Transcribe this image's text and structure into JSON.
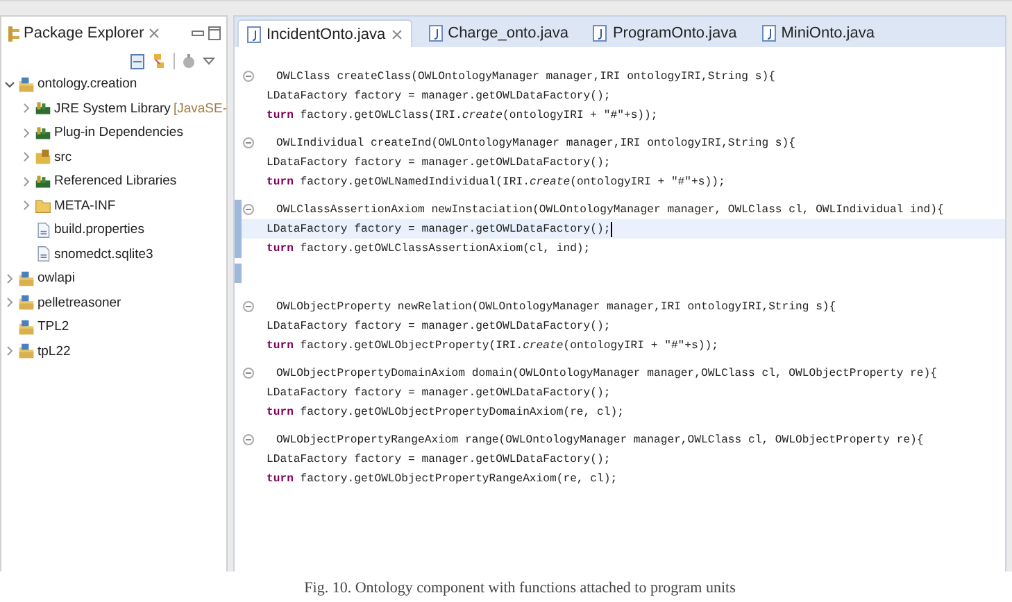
{
  "package_explorer": {
    "title": "Package Explorer",
    "tree": [
      {
        "label": "ontology.creation",
        "kind": "project",
        "expanded": true,
        "children": [
          {
            "label": "JRE System Library",
            "suffix": "[JavaSE-",
            "kind": "library",
            "expanded": false
          },
          {
            "label": "Plug-in Dependencies",
            "kind": "library",
            "expanded": false
          },
          {
            "label": "src",
            "kind": "source",
            "expanded": false
          },
          {
            "label": "Referenced Libraries",
            "kind": "library",
            "expanded": false
          },
          {
            "label": "META-INF",
            "kind": "folder",
            "expanded": false
          },
          {
            "label": "build.properties",
            "kind": "file"
          },
          {
            "label": "snomedct.sqlite3",
            "kind": "file"
          }
        ]
      },
      {
        "label": "owlapi",
        "kind": "project",
        "expanded": false
      },
      {
        "label": "pelletreasoner",
        "kind": "project",
        "expanded": false
      },
      {
        "label": "TPL2",
        "kind": "project"
      },
      {
        "label": "tpL22",
        "kind": "project",
        "expanded": false
      }
    ]
  },
  "editor": {
    "tabs": [
      {
        "label": "IncidentOnto.java",
        "selected": true
      },
      {
        "label": "Charge_onto.java",
        "selected": false
      },
      {
        "label": "ProgramOnto.java",
        "selected": false
      },
      {
        "label": "MiniOnto.java",
        "selected": false
      }
    ],
    "lines": [
      {
        "kind": "signature",
        "text": "OWLClass createClass(OWLOntologyManager manager,IRI ontologyIRI,String s){",
        "current": false,
        "marked": false
      },
      {
        "kind": "body",
        "text": "LDataFactory factory = manager.getOWLDataFactory();",
        "current": false,
        "marked": false
      },
      {
        "kind": "body",
        "text": "**turn** factory.getOWLClass(IRI.*create*(ontologyIRI + \"#\"+s));",
        "current": false,
        "marked": false
      },
      {
        "kind": "signature",
        "text": "OWLIndividual createInd(OWLOntologyManager manager,IRI ontologyIRI,String s){",
        "current": false,
        "marked": false
      },
      {
        "kind": "body",
        "text": "LDataFactory factory = manager.getOWLDataFactory();",
        "current": false,
        "marked": false
      },
      {
        "kind": "body",
        "text": "**turn**  factory.getOWLNamedIndividual(IRI.*create*(ontologyIRI + \"#\"+s));",
        "current": false,
        "marked": false
      },
      {
        "kind": "signature",
        "text": "OWLClassAssertionAxiom newInstaciation(OWLOntologyManager manager, OWLClass cl, OWLIndividual ind){",
        "current": false,
        "marked": true
      },
      {
        "kind": "body",
        "text": "LDataFactory factory = manager.getOWLDataFactory();",
        "current": true,
        "marked": true
      },
      {
        "kind": "body",
        "text": "**turn**  factory.getOWLClassAssertionAxiom(cl, ind);",
        "current": false,
        "marked": true
      },
      {
        "kind": "blank",
        "current": false,
        "marked": true
      },
      {
        "kind": "signature",
        "text": "OWLObjectProperty newRelation(OWLOntologyManager manager,IRI ontologyIRI,String s){",
        "current": false,
        "marked": false
      },
      {
        "kind": "body",
        "text": "LDataFactory factory = manager.getOWLDataFactory();",
        "current": false,
        "marked": false
      },
      {
        "kind": "body",
        "text": "**turn**  factory.getOWLObjectProperty(IRI.*create*(ontologyIRI + \"#\"+s));",
        "current": false,
        "marked": false
      },
      {
        "kind": "signature",
        "text": "OWLObjectPropertyDomainAxiom domain(OWLOntologyManager manager,OWLClass cl, OWLObjectProperty re){",
        "current": false,
        "marked": false
      },
      {
        "kind": "body",
        "text": "LDataFactory factory = manager.getOWLDataFactory();",
        "current": false,
        "marked": false
      },
      {
        "kind": "body",
        "text": "**turn**  factory.getOWLObjectPropertyDomainAxiom(re, cl);",
        "current": false,
        "marked": false
      },
      {
        "kind": "signature",
        "text": "OWLObjectPropertyRangeAxiom range(OWLOntologyManager manager,OWLClass cl, OWLObjectProperty re){",
        "current": false,
        "marked": false
      },
      {
        "kind": "body",
        "text": "LDataFactory factory = manager.getOWLDataFactory();",
        "current": false,
        "marked": false
      },
      {
        "kind": "body",
        "text": "**turn**  factory.getOWLObjectPropertyRangeAxiom(re, cl);",
        "current": false,
        "marked": false
      }
    ]
  },
  "caption": "Fig. 10. Ontology component with functions attached to program units"
}
